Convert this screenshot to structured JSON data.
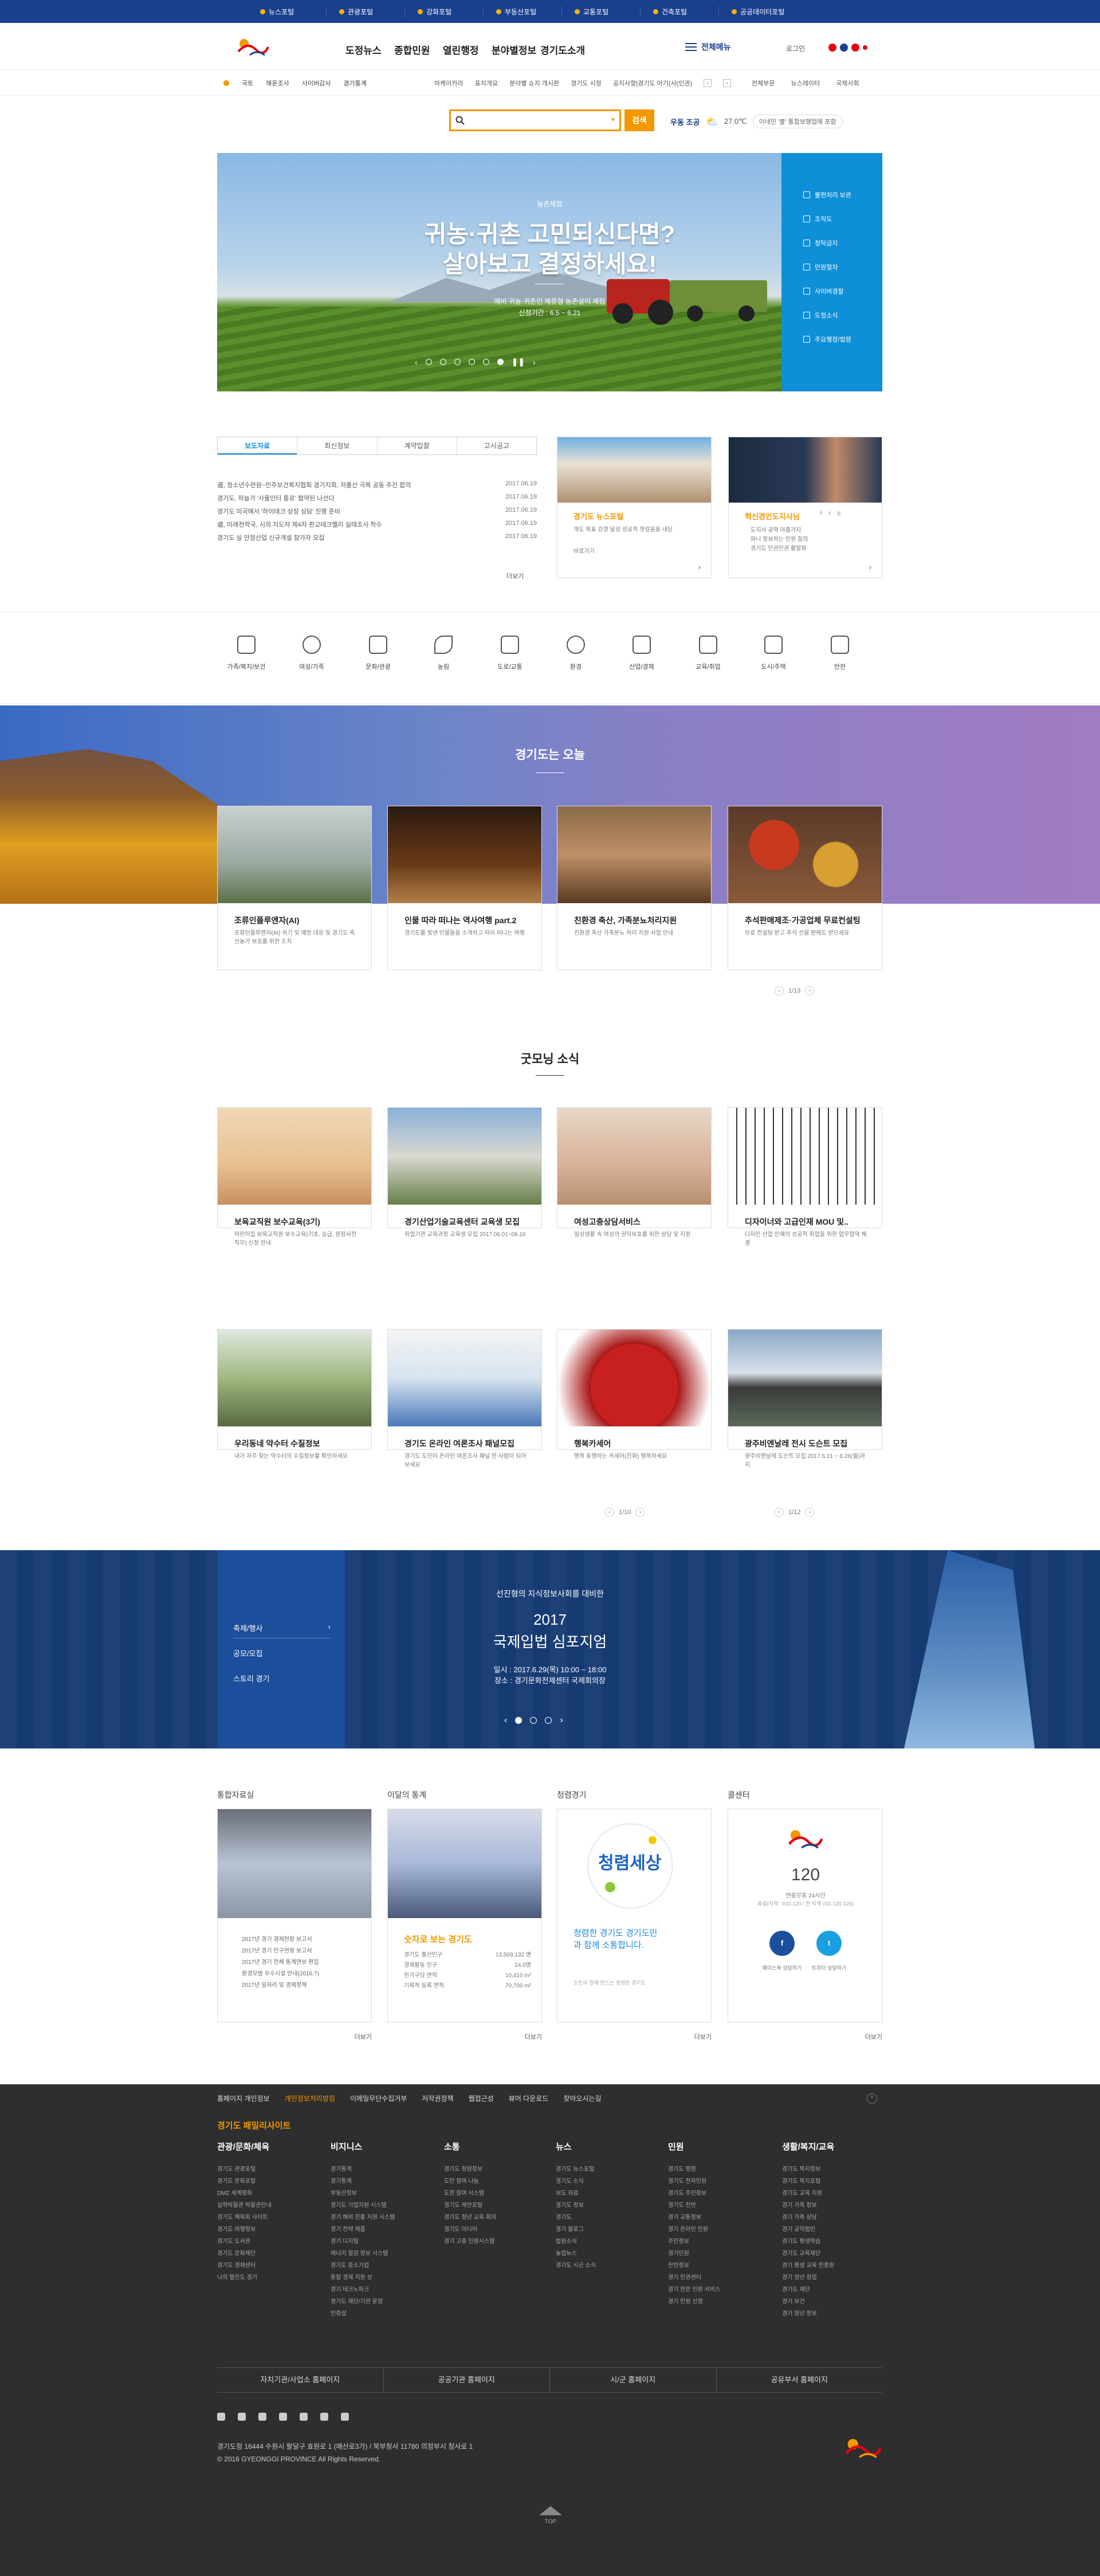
{
  "topbar": {
    "links": [
      "뉴스포털",
      "관광포털",
      "강화포털",
      "부동산포털",
      "교통포털",
      "건축포털",
      "공공데이터포털"
    ]
  },
  "header": {
    "logo_alt": "경기도",
    "gnb": [
      "도정뉴스",
      "종합민원",
      "열린행정",
      "분야별정보",
      "경기도소개"
    ],
    "allmenu": "전체메뉴",
    "login": "로그인",
    "lang_colors": [
      "#e60012",
      "#1b3f8f",
      "#e60012",
      "#e60012"
    ]
  },
  "util": {
    "left": [
      "국토",
      "해운조사",
      "사이버감사",
      "경기통계"
    ],
    "mid": [
      "마케이카라",
      "표지개요",
      "분야별 쇼지 개시판",
      "경기도 시정",
      "공지사항|경기도 아기(사(인권)"
    ],
    "right": [
      "전체부문",
      "뉴스레이터",
      "국제사회"
    ]
  },
  "search": {
    "placeholder": "",
    "button": "검색"
  },
  "weather": {
    "label": "우동 조공",
    "temp": "27.0℃",
    "trend": "이네민 '불' 통합보행업에 포함"
  },
  "hero": {
    "tag": "농촌체험",
    "title1": "귀농·귀촌 고민되신다면?",
    "title2": "살아보고 결정하세요!",
    "desc1": "예비 귀농·귀촌인 체류형 농촌살이 체험",
    "desc2": "신청기간 : 6.5 ~ 6.21",
    "quick": [
      "불편처리 보관",
      "조직도",
      "청탁금지",
      "민원절차",
      "사이버경찰",
      "도정소식",
      "주요행정/법령"
    ]
  },
  "news": {
    "tabs": [
      "보도자료",
      "최신정보",
      "계약입찰",
      "고시공고"
    ],
    "rows": [
      {
        "t": "道, 청소년수련원~민주보건복지협회 경기지회, 저출산 극복 공동 추진 합의",
        "d": "2017.06.19"
      },
      {
        "t": "경기도, 하늘가 '사물인터 통로' 협약된 나선다",
        "d": "2017.06.19"
      },
      {
        "t": "경기도 미국에서 '하이테크 상장 상담' 진행 준비",
        "d": "2017.06.19"
      },
      {
        "t": "道, 미래전략국, 시의 지도자 제4차 판교테크밸리 실태조사 착수",
        "d": "2017.06.19"
      },
      {
        "t": "경기도 실 안정산업 신규개설 참가자 모집",
        "d": "2017.06.19"
      }
    ],
    "more": "더보기",
    "card1": {
      "title": "경기도 뉴스포털",
      "desc": "개도 목표 강경 달성 성공적 첫걸음을 내딛",
      "link": "바로가기"
    },
    "card2": {
      "title": "혁신경인도지사님",
      "lines": [
        "도지사 공약 아홉가지",
        "파니 정보하는 민원 질의",
        "경기도 인권인권 활발화"
      ]
    }
  },
  "iconrow": [
    "가족/복지/보건",
    "여성/가족",
    "문화/관광",
    "농림",
    "도로/교통",
    "환경",
    "산업/경제",
    "교육/취업",
    "도시/주택",
    "안전"
  ],
  "today": {
    "title": "경기도는 오늘",
    "cards": [
      {
        "t": "조류인플루엔자(AI)",
        "d": "조류인플루엔자(AI) 위기 및 예방 대응 및 경기도 축산농가 보호를 위한 조치"
      },
      {
        "t": "인물 따라 떠나는 역사여행 part.2",
        "d": "경기도를 빛낸 인물들을 소개하고 따라 떠나는 여행"
      },
      {
        "t": "친환경 축산, 가족분뇨처리지원",
        "d": "친환경 축산 가축분뇨 처리 지원 사업 안내"
      },
      {
        "t": "추석판매제조·가공업체 무료컨설팅",
        "d": "무료 컨설팅 받고 추석 선물 판매도 받으세요"
      }
    ],
    "page": "1/13"
  },
  "goodmorning": {
    "title": "굿모닝 소식",
    "row1": [
      {
        "t": "보육교직원 보수교육(3기)",
        "d": "어린이집 보육교직원 보수교육(기초, 승급, 원장사전직무) 신청 안내"
      },
      {
        "t": "경기산업기술교육센터 교육생 모집",
        "d": "취업기관 교육과정 교육생 모집 2017.06.01~06.16"
      },
      {
        "t": "여성고충상담서비스",
        "d": "일상생활 속 여성의 권익보호를 위한 상담 및 지원"
      },
      {
        "t": "디자이너와 고급인재 MOU 및..",
        "d": "디자인 산업 인재의 성공적 취업을 위한 업무협약 체결"
      }
    ],
    "row2": [
      {
        "t": "우리동네 약수터 수질정보",
        "d": "내가 자주 찾는 약수터의 수질정보를 확인하세요"
      },
      {
        "t": "경기도 온라인 여론조사 패널모집",
        "d": "경기도 도민이 온라인 여론조사 패널 한 사람이 되어보세요"
      },
      {
        "t": "행복카세어",
        "d": "행복 동행하는 카세어(진화) 행복하세요"
      },
      {
        "t": "광주비엔날레 전시 도슨트 모집",
        "d": "광주비엔날레 도슨트 모집 2017.6.21 ~ 6.26(월)까지"
      }
    ],
    "page1": "1/10",
    "page2": "1/12"
  },
  "sympo": {
    "menu": [
      "축제/행사",
      "공모/모집",
      "스토리 경기"
    ],
    "sub": "선진형의 지식정보사회를 대비한",
    "year": "2017",
    "title": "국제입법 심포지엄",
    "date": "일시 : 2017.6.29(목) 10:00 ~ 18:00",
    "place": "장소 : 경기문화전제센터 국제회의장"
  },
  "bottom": {
    "b1": {
      "h": "통합자료실",
      "lines": [
        "2017년 경기 경제현황 보고서",
        "2017년 경기 인구현황 보고서",
        "2017년 경기 전체 통계연보 편집",
        "환경모범 우수시설 안내(2016.7)",
        "2017년 일자리 및 경제정책"
      ],
      "more": "더보기"
    },
    "b2": {
      "h": "이달의 통계",
      "headline": "숫자로 보는 경기도",
      "stats": [
        {
          "k": "경기도 출산인구",
          "v": "13,509,132 명"
        },
        {
          "k": "경제활동 인구",
          "v": "24,0명"
        },
        {
          "k": "한가구당 면적",
          "v": "10,410 m²"
        },
        {
          "k": "기록적 등록 면적",
          "v": "70,700 m²"
        }
      ],
      "more": "더보기"
    },
    "b3": {
      "h": "청렴경기",
      "logo": "청렴세상",
      "text": "청렴한 경기도 경기도민과 함께 소통합니다.",
      "sub": "도민과 함께 만드는 청렴한 경기도",
      "more": "더보기"
    },
    "b4": {
      "h": "콜센터",
      "num": "120",
      "desc": "연중무휴 24시간",
      "desc2": "유료(지역 : 031-120 / 전 지역 031-120-120)",
      "sns1": "페이스북 상담하기",
      "sns2": "트위터 상담하기",
      "more": "더보기"
    }
  },
  "footer": {
    "links": [
      "홈페이지 개인정보",
      "개인정보처리방침",
      "이메일무단수집거부",
      "저작권정책",
      "웹접근성",
      "뷰어 다운로드",
      "찾아오시는길"
    ],
    "sitemap": "경기도 패밀리사이트",
    "cols": [
      {
        "h": "관광/문화/체육",
        "items": [
          "경기도 관광포털",
          "경기도 문화포털",
          "DMZ 세계평화",
          "실학박물관 박물관안내",
          "경기도 체육회 사이트",
          "경기도 여행정보",
          "경기도 도서관",
          "경기도 문화재단",
          "경기도 경제센터",
          "나의 웹진도 경기"
        ]
      },
      {
        "h": "비지니스",
        "items": [
          "경기통계",
          "경기통계",
          "부동산정보",
          "경기도 기업지원 시스템",
          "경기 해외 진출 지원 시스템",
          "경기 전략 제품",
          "경기 디지털",
          "에너지 절감 정보 시스템",
          "경기도 중소기업",
          "통합 경제 지원 상",
          "경기 테크노파크",
          "경기도 재단/기관 운영",
          "인증샵"
        ]
      },
      {
        "h": "소통",
        "items": [
          "경기도 청렴정보",
          "도민 참여 나눔",
          "도전 참여 시스템",
          "경기도 제안포탈",
          "경기도 청년 교육 회의",
          "경기도 미디어",
          "경기 고충 민원시스템"
        ]
      },
      {
        "h": "뉴스",
        "items": [
          "경기도 뉴스포털",
          "경기도 소식",
          "보도 자료",
          "경기도 정보",
          "경기도",
          "경기 블로그",
          "법원소식",
          "농업뉴스",
          "경기도 시군 소식"
        ]
      },
      {
        "h": "민원",
        "items": [
          "경기도 행정",
          "경기도 전자민원",
          "경기도 주민정보",
          "경기도 찬반",
          "경기 교통정보",
          "경기 온라인 민원",
          "주민정보",
          "경기민원",
          "찬반정보",
          "경기 인권센터",
          "경기 전문 민원 서비스",
          "경기 민원 신청"
        ]
      },
      {
        "h": "생활/복지/교육",
        "items": [
          "경기도 복지정보",
          "경기도 복지포털",
          "경기도 교육 지원",
          "경기 가족 정보",
          "경기 가족 상담",
          "경기 공익법인",
          "경기도 평생학습",
          "경기도 교육재단",
          "경기 평생 교육 진흥원",
          "경기 청년 창업",
          "경기도 재단",
          "경기 보건",
          "경기 청년 정보"
        ]
      }
    ],
    "portals": [
      "자치기관/사업소 홈페이지",
      "공공기관 홈페이지",
      "시/군 홈페이지",
      "공유부서 홈페이지"
    ],
    "address": "경기도청 16444 수원시 팔달구 효원로 1 (매산로3가) / 북부청사 11780 의정부시 청사로 1",
    "copy": "© 2016 GYEONGGI PROVINCE All Rights Reserved.",
    "top": "TOP"
  }
}
